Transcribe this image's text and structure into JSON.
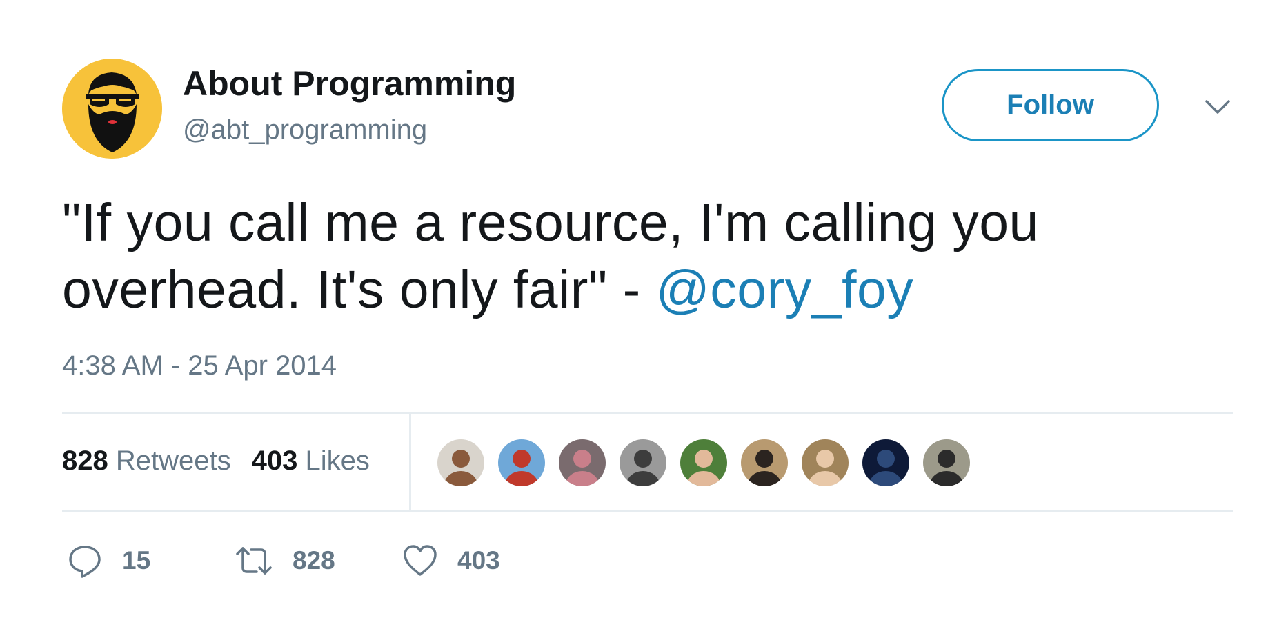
{
  "author": {
    "display_name": "About Programming",
    "handle": "@abt_programming"
  },
  "follow_button": {
    "label": "Follow"
  },
  "tweet": {
    "text_before": "\"If you call me a resource, I'm calling you overhead. It's only fair\" - ",
    "mention": "@cory_foy",
    "timestamp": "4:38 AM - 25 Apr 2014"
  },
  "stats": {
    "retweets_count": "828",
    "retweets_label": "Retweets",
    "likes_count": "403",
    "likes_label": "Likes"
  },
  "likers": [
    {
      "name": "liker-avatar-1",
      "bg": "#d9d4cc",
      "fg": "#8a5a3c"
    },
    {
      "name": "liker-avatar-2",
      "bg": "#6fa8d8",
      "fg": "#c0392b"
    },
    {
      "name": "liker-avatar-3",
      "bg": "#7a6b6e",
      "fg": "#c97f8a"
    },
    {
      "name": "liker-avatar-4",
      "bg": "#9a9a9a",
      "fg": "#3d3d3d"
    },
    {
      "name": "liker-avatar-5",
      "bg": "#4e7f3a",
      "fg": "#e2b99a"
    },
    {
      "name": "liker-avatar-6",
      "bg": "#b89a70",
      "fg": "#2b2420"
    },
    {
      "name": "liker-avatar-7",
      "bg": "#a0845a",
      "fg": "#e8c8a8"
    },
    {
      "name": "liker-avatar-8",
      "bg": "#0e1a38",
      "fg": "#2d4a7a"
    },
    {
      "name": "liker-avatar-9",
      "bg": "#9c9a8a",
      "fg": "#2b2b2b"
    }
  ],
  "actions": {
    "reply_count": "15",
    "retweet_count": "828",
    "like_count": "403"
  },
  "colors": {
    "link": "#1b7fb5",
    "secondary_text": "#657786",
    "divider": "#e6ecf0",
    "avatar_bg": "#f7c23a"
  },
  "icons": {
    "reply": "speech-bubble",
    "retweet": "retweet-arrows",
    "like": "heart",
    "menu": "chevron-down"
  }
}
